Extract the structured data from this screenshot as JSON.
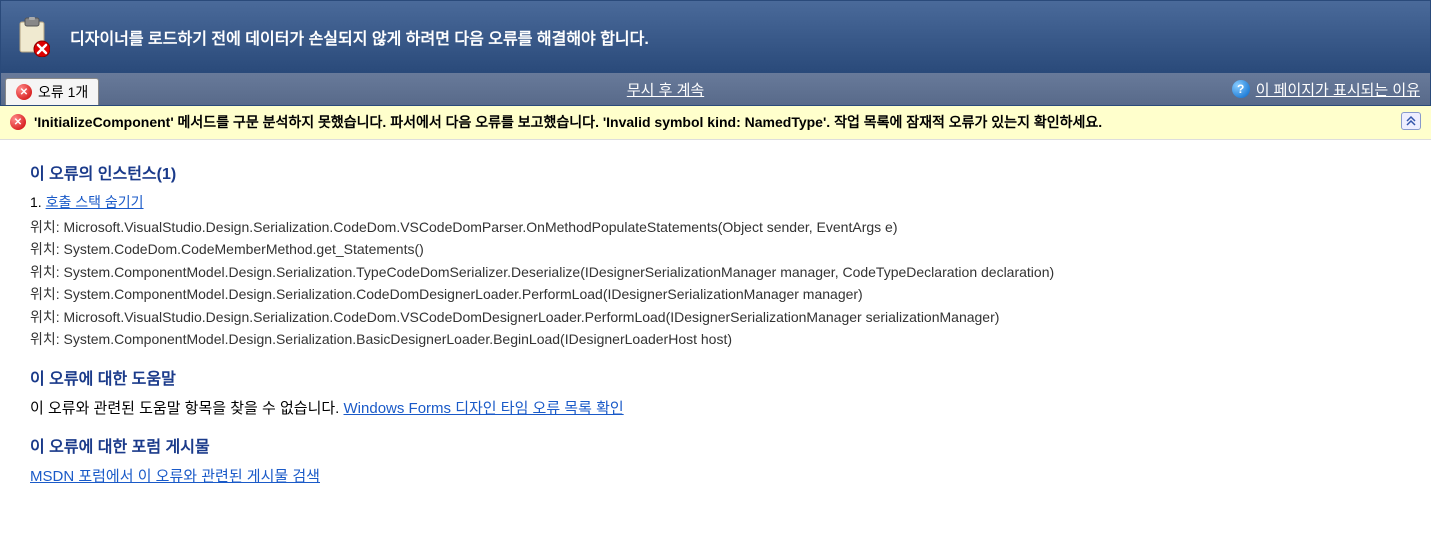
{
  "header": {
    "title": "디자이너를 로드하기 전에 데이터가 손실되지 않게 하려면 다음 오류를 해결해야 합니다."
  },
  "toolbar": {
    "error_tab_label": "오류 1개",
    "continue_link": "무시 후 계속",
    "help_link": "이 페이지가 표시되는 이유"
  },
  "warning": {
    "message": "'InitializeComponent' 메서드를 구문 분석하지 못했습니다. 파서에서 다음 오류를 보고했습니다. 'Invalid symbol kind: NamedType'. 작업 목록에 잠재적 오류가 있는지 확인하세요."
  },
  "sections": {
    "instances_title": "이 오류의 인스턴스(1)",
    "hide_stack_label": "호출 스택 숨기기",
    "stack": [
      "위치: Microsoft.VisualStudio.Design.Serialization.CodeDom.VSCodeDomParser.OnMethodPopulateStatements(Object sender, EventArgs e)",
      "위치: System.CodeDom.CodeMemberMethod.get_Statements()",
      "위치: System.ComponentModel.Design.Serialization.TypeCodeDomSerializer.Deserialize(IDesignerSerializationManager manager, CodeTypeDeclaration declaration)",
      "위치: System.ComponentModel.Design.Serialization.CodeDomDesignerLoader.PerformLoad(IDesignerSerializationManager manager)",
      "위치: Microsoft.VisualStudio.Design.Serialization.CodeDom.VSCodeDomDesignerLoader.PerformLoad(IDesignerSerializationManager serializationManager)",
      "위치: System.ComponentModel.Design.Serialization.BasicDesignerLoader.BeginLoad(IDesignerLoaderHost host)"
    ],
    "help_title": "이 오류에 대한 도움말",
    "help_text": "이 오류와 관련된 도움말 항목을 찾을 수 없습니다. ",
    "help_link": "Windows Forms 디자인 타임 오류 목록 확인",
    "forum_title": "이 오류에 대한 포럼 게시물",
    "forum_link": "MSDN 포럼에서 이 오류와 관련된 게시물 검색"
  }
}
